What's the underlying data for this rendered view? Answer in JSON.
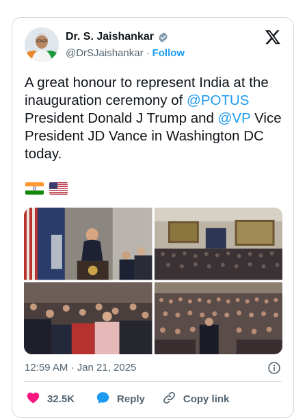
{
  "author": {
    "name": "Dr. S. Jaishankar",
    "handle": "@DrSJaishankar",
    "separator": "·",
    "follow_label": "Follow"
  },
  "tweet": {
    "text_part1": "A great honour to represent India at the inauguration ceremony of ",
    "mention1": "@POTUS",
    "text_part2": " President Donald J Trump and ",
    "mention2": "@VP",
    "text_part3": " Vice President JD Vance in Washington DC today."
  },
  "flags": [
    "india-flag",
    "us-flag"
  ],
  "timestamp": "12:59 AM · Jan 21, 2025",
  "actions": {
    "like_count": "32.5K",
    "reply_label": "Reply",
    "copy_link_label": "Copy link"
  },
  "colors": {
    "accent": "#1d9bf0",
    "like": "#f91880",
    "text": "#0f1419",
    "muted": "#536471"
  }
}
